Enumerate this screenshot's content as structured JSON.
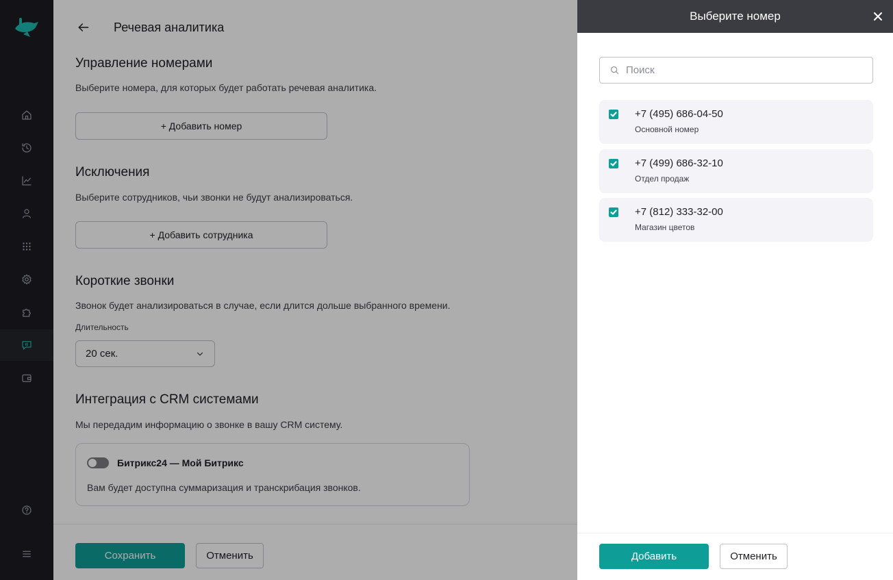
{
  "app": {
    "page_title": "Речевая аналитика"
  },
  "sidebar": {
    "items": [
      {
        "icon": "home-icon"
      },
      {
        "icon": "history-icon"
      },
      {
        "icon": "chart-icon"
      },
      {
        "icon": "user-icon"
      },
      {
        "icon": "dialpad-icon"
      },
      {
        "icon": "gear-icon"
      },
      {
        "icon": "puzzle-icon"
      },
      {
        "icon": "speech-analytics-icon",
        "active": true
      },
      {
        "icon": "wallet-icon"
      }
    ],
    "bottom_items": [
      {
        "icon": "help-icon"
      },
      {
        "icon": "menu-icon"
      }
    ],
    "accent_color": "#20b8b0"
  },
  "sections": {
    "numbers": {
      "title": "Управление номерами",
      "description": "Выберите номера, для которых будет работать речевая аналитика.",
      "button_label": "+ Добавить номер"
    },
    "exclusions": {
      "title": "Исключения",
      "description": "Выберите сотрудников, чьи звонки не будут анализироваться.",
      "button_label": "+ Добавить сотрудника"
    },
    "short_calls": {
      "title": "Короткие звонки",
      "description": "Звонок будет анализироваться в случае, если длится дольше выбранного времени.",
      "field_label": "Длительность",
      "selected_value": "20 сек."
    },
    "crm": {
      "title": "Интеграция с CRM системами",
      "description": "Мы передадим информацию о звонке в вашу CRM систему.",
      "integration_name": "Битрикс24 — Мой Битрикс",
      "integration_description": "Вам будет доступна суммаризация и транскрибация звонков.",
      "enabled": false
    }
  },
  "main_footer": {
    "save_label": "Сохранить",
    "cancel_label": "Отменить"
  },
  "drawer": {
    "title": "Выберите номер",
    "search_placeholder": "Поиск",
    "search_value": "",
    "numbers": [
      {
        "number": "+7 (495) 686-04-50",
        "label": "Основной номер",
        "checked": true
      },
      {
        "number": "+7 (499) 686-32-10",
        "label": "Отдел продаж",
        "checked": true
      },
      {
        "number": "+7 (812) 333-32-00",
        "label": "Магазин цветов",
        "checked": true
      }
    ],
    "add_label": "Добавить",
    "cancel_label": "Отменить"
  },
  "colors": {
    "primary": "#0f9d97",
    "drawer_header": "#3b3c42",
    "rail_bg": "#1c1d22"
  }
}
